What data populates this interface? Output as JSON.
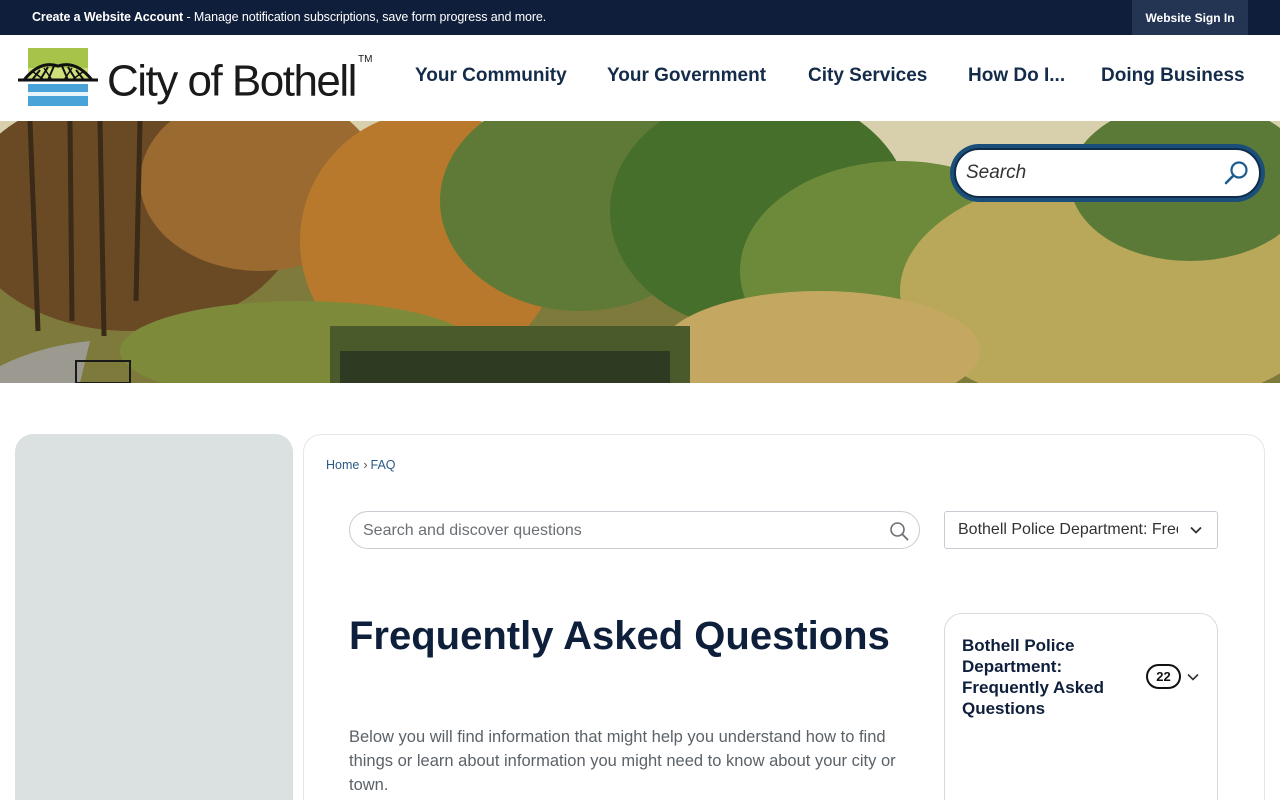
{
  "topbar": {
    "create_account_label": "Create a Website Account",
    "notice_text": " - Manage notification subscriptions, save form progress and more.",
    "sign_in_label": "Website Sign In"
  },
  "header": {
    "site_name": "City of Bothell",
    "trademark": "TM",
    "nav": [
      "Your Community",
      "Your Government",
      "City Services",
      "How Do I...",
      "Doing Business"
    ]
  },
  "hero": {
    "search_placeholder": "Search"
  },
  "breadcrumb": {
    "home": "Home",
    "separator": "›",
    "current": "FAQ"
  },
  "faq": {
    "search_placeholder": "Search and discover questions",
    "category_select_value": "Bothell Police Department: Frequently Asked Questions",
    "title": "Frequently Asked Questions",
    "intro": "Below you will find information that might help you understand how to find things or learn about information you might need to know about your city or town.",
    "categories": [
      {
        "label": "Bothell Police Department: Frequently Asked Questions",
        "count": "22"
      }
    ]
  },
  "colors": {
    "topbar_bg": "#0f1e3a",
    "nav_text": "#142b4a",
    "heading_text": "#0e1f3c",
    "link": "#2a5b86",
    "sidebar_bg": "#dbe0e0",
    "search_ring": "#1b4f7a"
  },
  "icons": {
    "hero_search": "magnifier-icon",
    "faq_search": "magnifier-icon",
    "select_chevron": "chevron-down-icon",
    "category_chevron": "chevron-down-icon",
    "logo": "bridge-logo-icon"
  }
}
